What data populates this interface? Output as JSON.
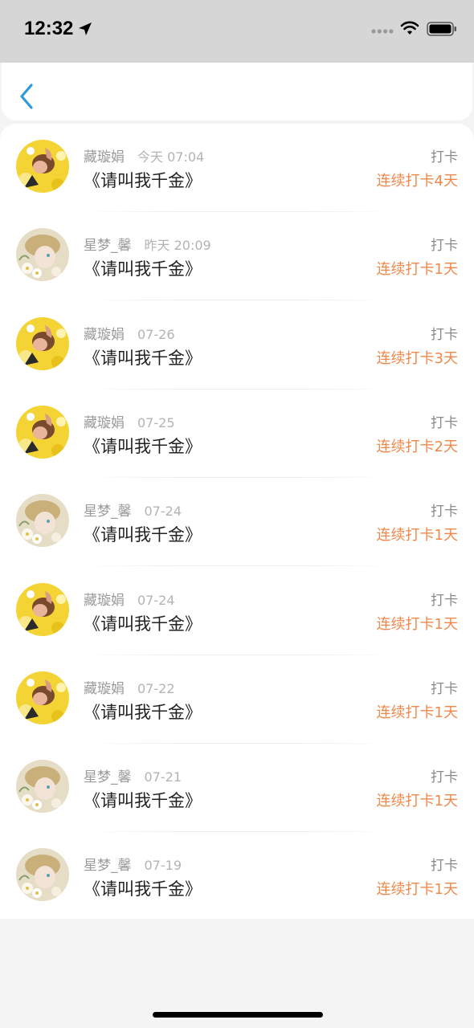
{
  "status_bar": {
    "time": "12:32"
  },
  "nav": {
    "back_icon": "chevron-left-icon",
    "accent": "#2f9bd6"
  },
  "colors": {
    "streak": "#f0884a",
    "background": "#f4f4f4"
  },
  "records": [
    {
      "name": "藏璇娟",
      "time": "今天 07:04",
      "title": "《请叫我千金》",
      "action": "打卡",
      "streak": "连续打卡4天",
      "avatar": "yellow"
    },
    {
      "name": "星梦_馨",
      "time": "昨天 20:09",
      "title": "《请叫我千金》",
      "action": "打卡",
      "streak": "连续打卡1天",
      "avatar": "pale"
    },
    {
      "name": "藏璇娟",
      "time": "07-26",
      "title": "《请叫我千金》",
      "action": "打卡",
      "streak": "连续打卡3天",
      "avatar": "yellow"
    },
    {
      "name": "藏璇娟",
      "time": "07-25",
      "title": "《请叫我千金》",
      "action": "打卡",
      "streak": "连续打卡2天",
      "avatar": "yellow"
    },
    {
      "name": "星梦_馨",
      "time": "07-24",
      "title": "《请叫我千金》",
      "action": "打卡",
      "streak": "连续打卡1天",
      "avatar": "pale"
    },
    {
      "name": "藏璇娟",
      "time": "07-24",
      "title": "《请叫我千金》",
      "action": "打卡",
      "streak": "连续打卡1天",
      "avatar": "yellow"
    },
    {
      "name": "藏璇娟",
      "time": "07-22",
      "title": "《请叫我千金》",
      "action": "打卡",
      "streak": "连续打卡1天",
      "avatar": "yellow"
    },
    {
      "name": "星梦_馨",
      "time": "07-21",
      "title": "《请叫我千金》",
      "action": "打卡",
      "streak": "连续打卡1天",
      "avatar": "pale"
    },
    {
      "name": "星梦_馨",
      "time": "07-19",
      "title": "《请叫我千金》",
      "action": "打卡",
      "streak": "连续打卡1天",
      "avatar": "pale"
    }
  ]
}
